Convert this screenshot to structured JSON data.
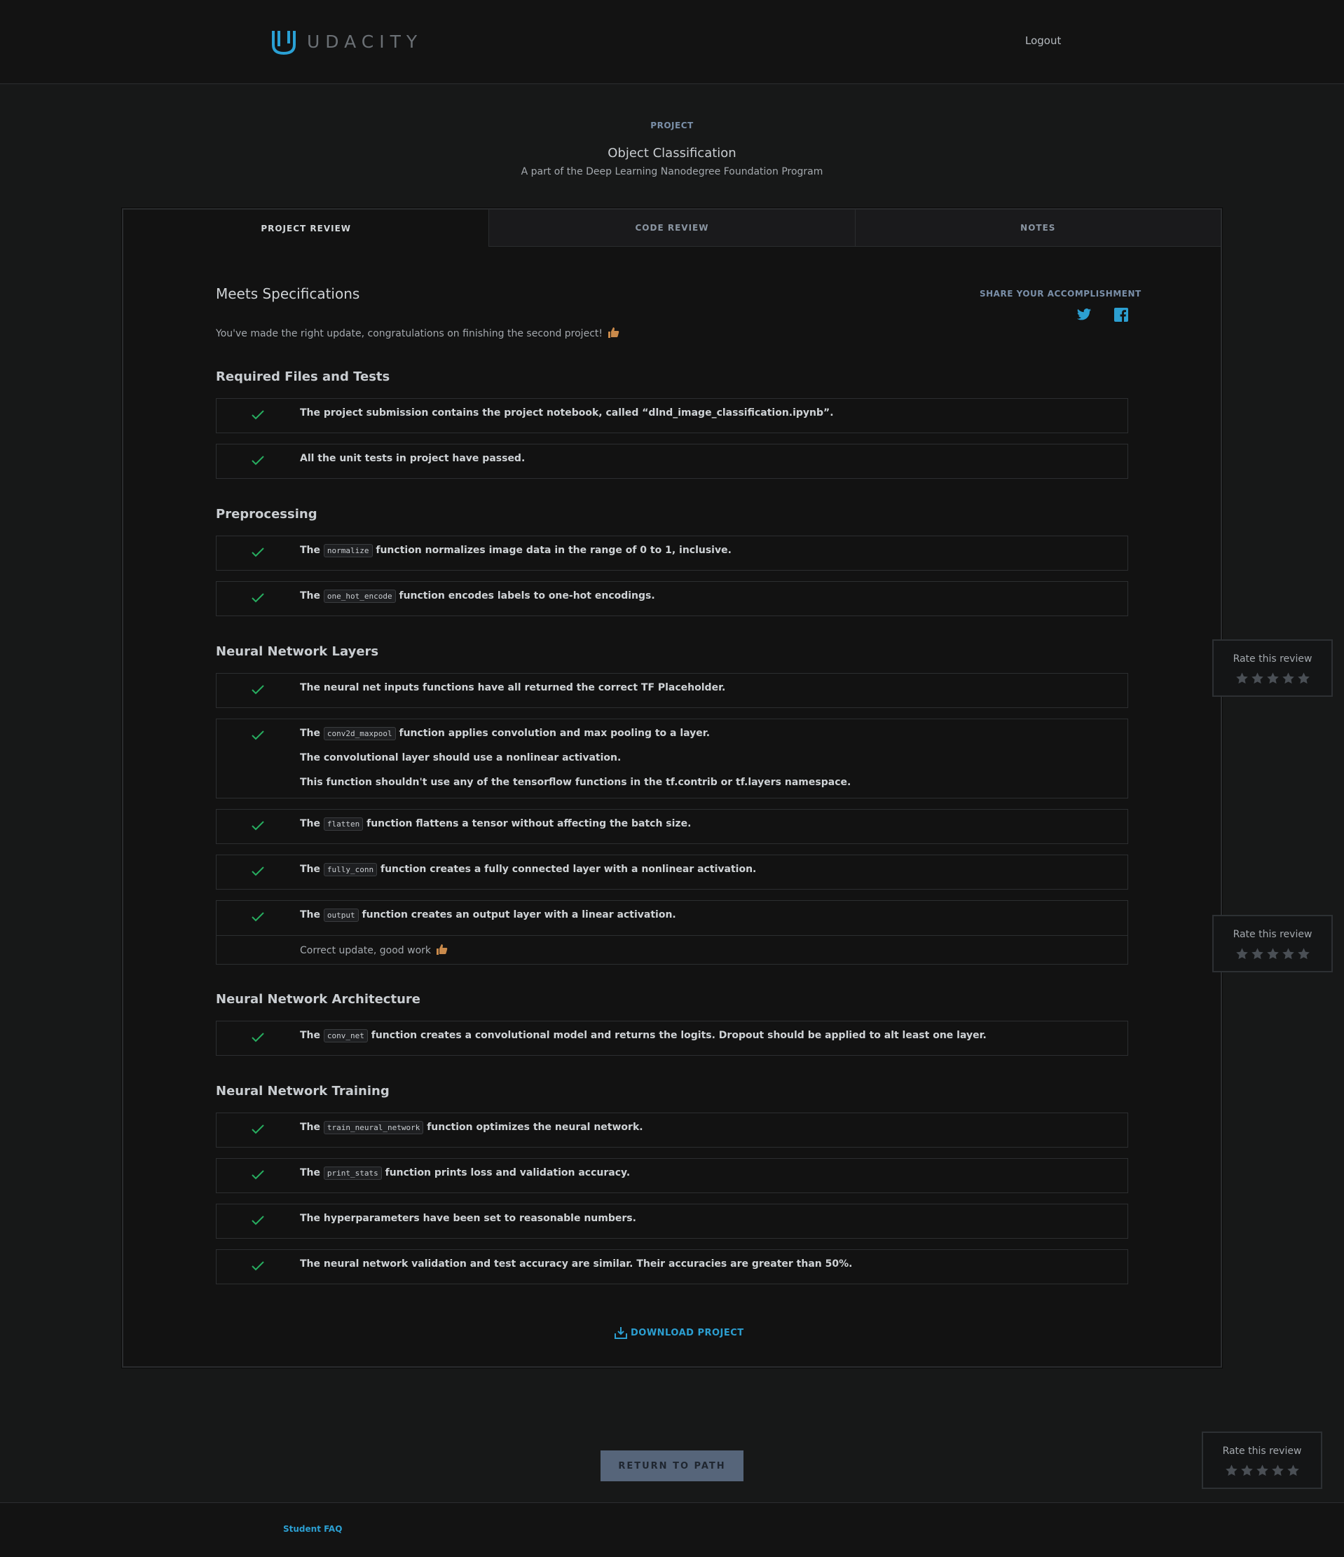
{
  "header": {
    "logo_text": "UDACITY",
    "logout_label": "Logout"
  },
  "project": {
    "label": "PROJECT",
    "title": "Object Classification",
    "subtitle": "A part of the Deep Learning Nanodegree Foundation Program"
  },
  "tabs": [
    "PROJECT REVIEW",
    "CODE REVIEW",
    "NOTES"
  ],
  "review": {
    "status": "Meets Specifications",
    "share_label": "SHARE YOUR ACCOMPLISHMENT",
    "intro": "You've made the right update, congratulations on finishing the second project!",
    "sections": [
      {
        "title": "Required Files and Tests",
        "specs": [
          {
            "lines": [
              "The project submission contains the project notebook, called “dlnd_image_classification.ipynb”."
            ]
          },
          {
            "lines": [
              "All the unit tests in project have passed."
            ]
          }
        ]
      },
      {
        "title": "Preprocessing",
        "specs": [
          {
            "pre": "The",
            "code": "normalize",
            "post": "function normalizes image data in the range of 0 to 1, inclusive."
          },
          {
            "pre": "The",
            "code": "one_hot_encode",
            "post": "function encodes labels to one-hot encodings."
          }
        ]
      },
      {
        "title": "Neural Network Layers",
        "specs": [
          {
            "lines": [
              "The neural net inputs functions have all returned the correct TF Placeholder."
            ]
          },
          {
            "pre": "The",
            "code": "conv2d_maxpool",
            "post": "function applies convolution and max pooling to a layer.",
            "extra": [
              "The convolutional layer should use a nonlinear activation.",
              "This function shouldn't use any of the tensorflow functions in the tf.contrib or tf.layers namespace."
            ]
          },
          {
            "pre": "The",
            "code": "flatten",
            "post": "function flattens a tensor without affecting the batch size."
          },
          {
            "pre": "The",
            "code": "fully_conn",
            "post": "function creates a fully connected layer with a nonlinear activation."
          },
          {
            "pre": "The",
            "code": "output",
            "post": "function creates an output layer with a linear activation.",
            "note": "Correct update, good work"
          }
        ]
      },
      {
        "title": "Neural Network Architecture",
        "specs": [
          {
            "pre": "The",
            "code": "conv_net",
            "post": "function creates a convolutional model and returns the logits. Dropout should be applied to alt least one layer."
          }
        ]
      },
      {
        "title": "Neural Network Training",
        "specs": [
          {
            "pre": "The",
            "code": "train_neural_network",
            "post": "function optimizes the neural network."
          },
          {
            "pre": "The",
            "code": "print_stats",
            "post": "function prints loss and validation accuracy."
          },
          {
            "lines": [
              "The hyperparameters have been set to reasonable numbers."
            ]
          },
          {
            "lines": [
              "The neural network validation and test accuracy are similar. Their accuracies are greater than 50%."
            ]
          }
        ]
      }
    ],
    "download_label": "DOWNLOAD PROJECT"
  },
  "rate_widget": {
    "label": "Rate this review",
    "stars": 5
  },
  "return_label": "RETURN TO PATH",
  "footer": {
    "faq_label": "Student FAQ"
  },
  "icons": {
    "check": "check-icon",
    "twitter": "twitter-icon",
    "facebook": "facebook-icon",
    "thumbs_up": "thumbs-up-icon",
    "download": "download-icon",
    "star": "star-icon"
  },
  "colors": {
    "accent": "#2c9fd1",
    "check": "#27ae60",
    "button": "#56657a",
    "label": "#7a8fa8"
  }
}
